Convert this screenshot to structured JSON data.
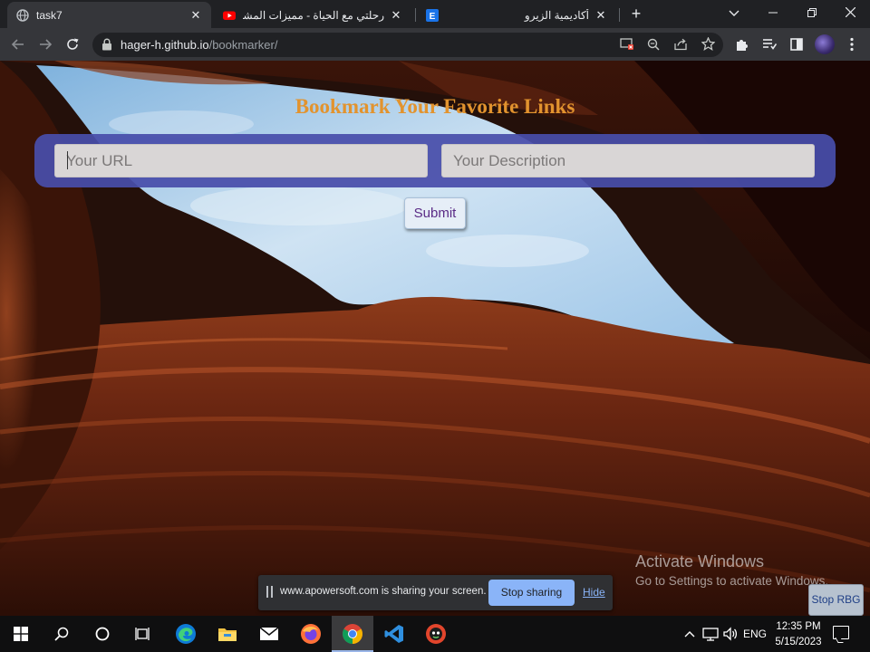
{
  "browser": {
    "tabs": [
      {
        "title": "task7",
        "icon": "globe-icon",
        "active": true
      },
      {
        "title": "رحلتي مع الحياة - مميزات المشاكل",
        "icon": "youtube-icon",
        "active": false
      },
      {
        "title": "أكاديمية الزيرو",
        "icon": "e-site-icon",
        "active": false
      }
    ],
    "new_tab_label": "+",
    "url_host": "hager-h.github.io",
    "url_path": "/bookmarker/"
  },
  "page": {
    "heading": "Bookmark Your Favorite Links",
    "url_placeholder": "Your URL",
    "description_placeholder": "Your Description",
    "submit_label": "Submit",
    "colors": {
      "heading": "#e2932e",
      "form_bar": "#484eaa",
      "submit_text": "#5a2a86"
    }
  },
  "windows_watermark": {
    "line1": "Activate Windows",
    "line2": "Go to Settings to activate Windows."
  },
  "share_bar": {
    "message": "www.apowersoft.com is sharing your screen.",
    "stop_label": "Stop sharing",
    "hide_label": "Hide"
  },
  "stop_rbg_label": "Stop RBG",
  "taskbar": {
    "apps": [
      "windows-start-icon",
      "search-icon",
      "cortana-icon",
      "task-view-icon",
      "edge-icon",
      "file-explorer-icon",
      "mail-icon",
      "firefox-icon",
      "chrome-icon",
      "vscode-icon",
      "app-icon"
    ],
    "language": "ENG",
    "time": "12:35 PM",
    "date": "5/15/2023"
  }
}
